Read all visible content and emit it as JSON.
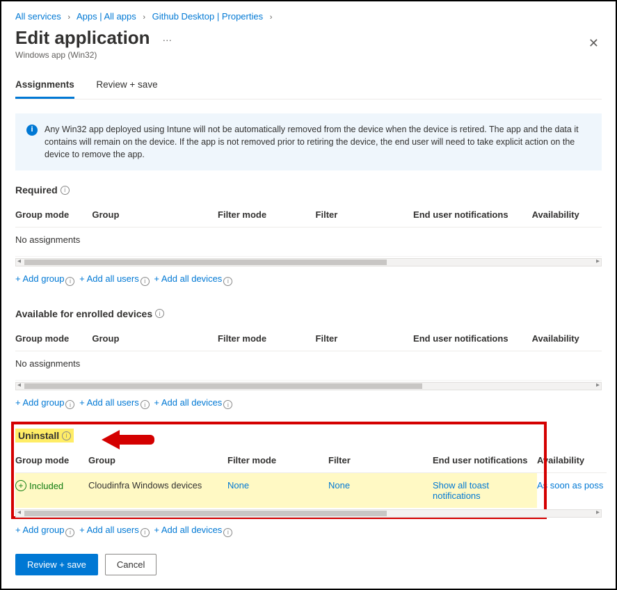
{
  "breadcrumb": {
    "items": [
      "All services",
      "Apps | All apps",
      "Github Desktop | Properties"
    ]
  },
  "header": {
    "title": "Edit application",
    "subtitle": "Windows app (Win32)"
  },
  "tabs": {
    "assignments": "Assignments",
    "review": "Review + save"
  },
  "banner": {
    "text": "Any Win32 app deployed using Intune will not be automatically removed from the device when the device is retired. The app and the data it contains will remain on the device. If the app is not removed prior to retiring the device, the end user will need to take explicit action on the device to remove the app."
  },
  "columns": {
    "mode": "Group mode",
    "group": "Group",
    "fmode": "Filter mode",
    "filter": "Filter",
    "notif": "End user notifications",
    "avail": "Availability"
  },
  "sections": {
    "required": {
      "title": "Required",
      "empty": "No assignments"
    },
    "available": {
      "title": "Available for enrolled devices",
      "empty": "No assignments"
    },
    "uninstall": {
      "title": "Uninstall",
      "row": {
        "mode": "Included",
        "group": "Cloudinfra Windows devices",
        "fmode": "None",
        "filter": "None",
        "notif": "Show all toast notifications",
        "avail": "As soon as poss"
      }
    }
  },
  "add_links": {
    "group": "+ Add group",
    "users": "+ Add all users",
    "devices": "+ Add all devices"
  },
  "footer": {
    "primary": "Review + save",
    "cancel": "Cancel"
  }
}
